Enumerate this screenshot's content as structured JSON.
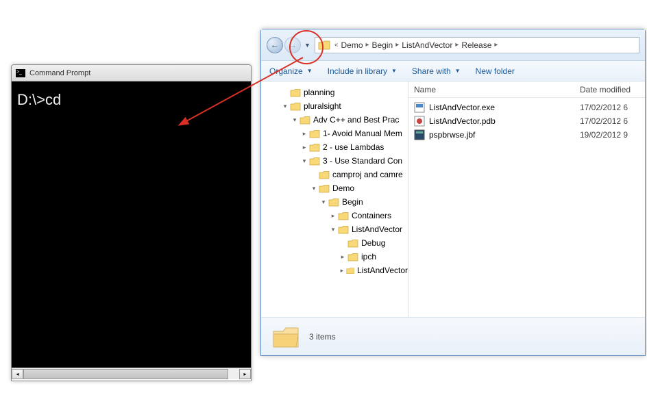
{
  "cmd": {
    "title": "Command Prompt",
    "line1": "D:\\>cd"
  },
  "explorer": {
    "breadcrumb": [
      "Demo",
      "Begin",
      "ListAndVector",
      "Release"
    ],
    "toolbar": {
      "organize": "Organize",
      "include": "Include in library",
      "share": "Share with",
      "newfolder": "New folder"
    },
    "columns": {
      "name": "Name",
      "date": "Date modified"
    },
    "tree": [
      {
        "label": "planning",
        "indent": 30,
        "toggle": ""
      },
      {
        "label": "pluralsight",
        "indent": 30,
        "toggle": "▾"
      },
      {
        "label": "Adv C++ and Best Prac",
        "indent": 44,
        "toggle": "▾"
      },
      {
        "label": "1- Avoid Manual Mem",
        "indent": 58,
        "toggle": "▸"
      },
      {
        "label": "2 - use Lambdas",
        "indent": 58,
        "toggle": "▸"
      },
      {
        "label": "3 - Use Standard Con",
        "indent": 58,
        "toggle": "▾"
      },
      {
        "label": "camproj and camre",
        "indent": 72,
        "toggle": ""
      },
      {
        "label": "Demo",
        "indent": 72,
        "toggle": "▾"
      },
      {
        "label": "Begin",
        "indent": 86,
        "toggle": "▾"
      },
      {
        "label": "Containers",
        "indent": 100,
        "toggle": "▸"
      },
      {
        "label": "ListAndVector",
        "indent": 100,
        "toggle": "▾"
      },
      {
        "label": "Debug",
        "indent": 114,
        "toggle": ""
      },
      {
        "label": "ipch",
        "indent": 114,
        "toggle": "▸"
      },
      {
        "label": "ListAndVector",
        "indent": 114,
        "toggle": "▸"
      }
    ],
    "files": [
      {
        "name": "ListAndVector.exe",
        "date": "17/02/2012 6",
        "icon": "exe"
      },
      {
        "name": "ListAndVector.pdb",
        "date": "17/02/2012 6",
        "icon": "pdb"
      },
      {
        "name": "pspbrwse.jbf",
        "date": "19/02/2012 9",
        "icon": "jbf"
      }
    ],
    "status": "3 items"
  }
}
